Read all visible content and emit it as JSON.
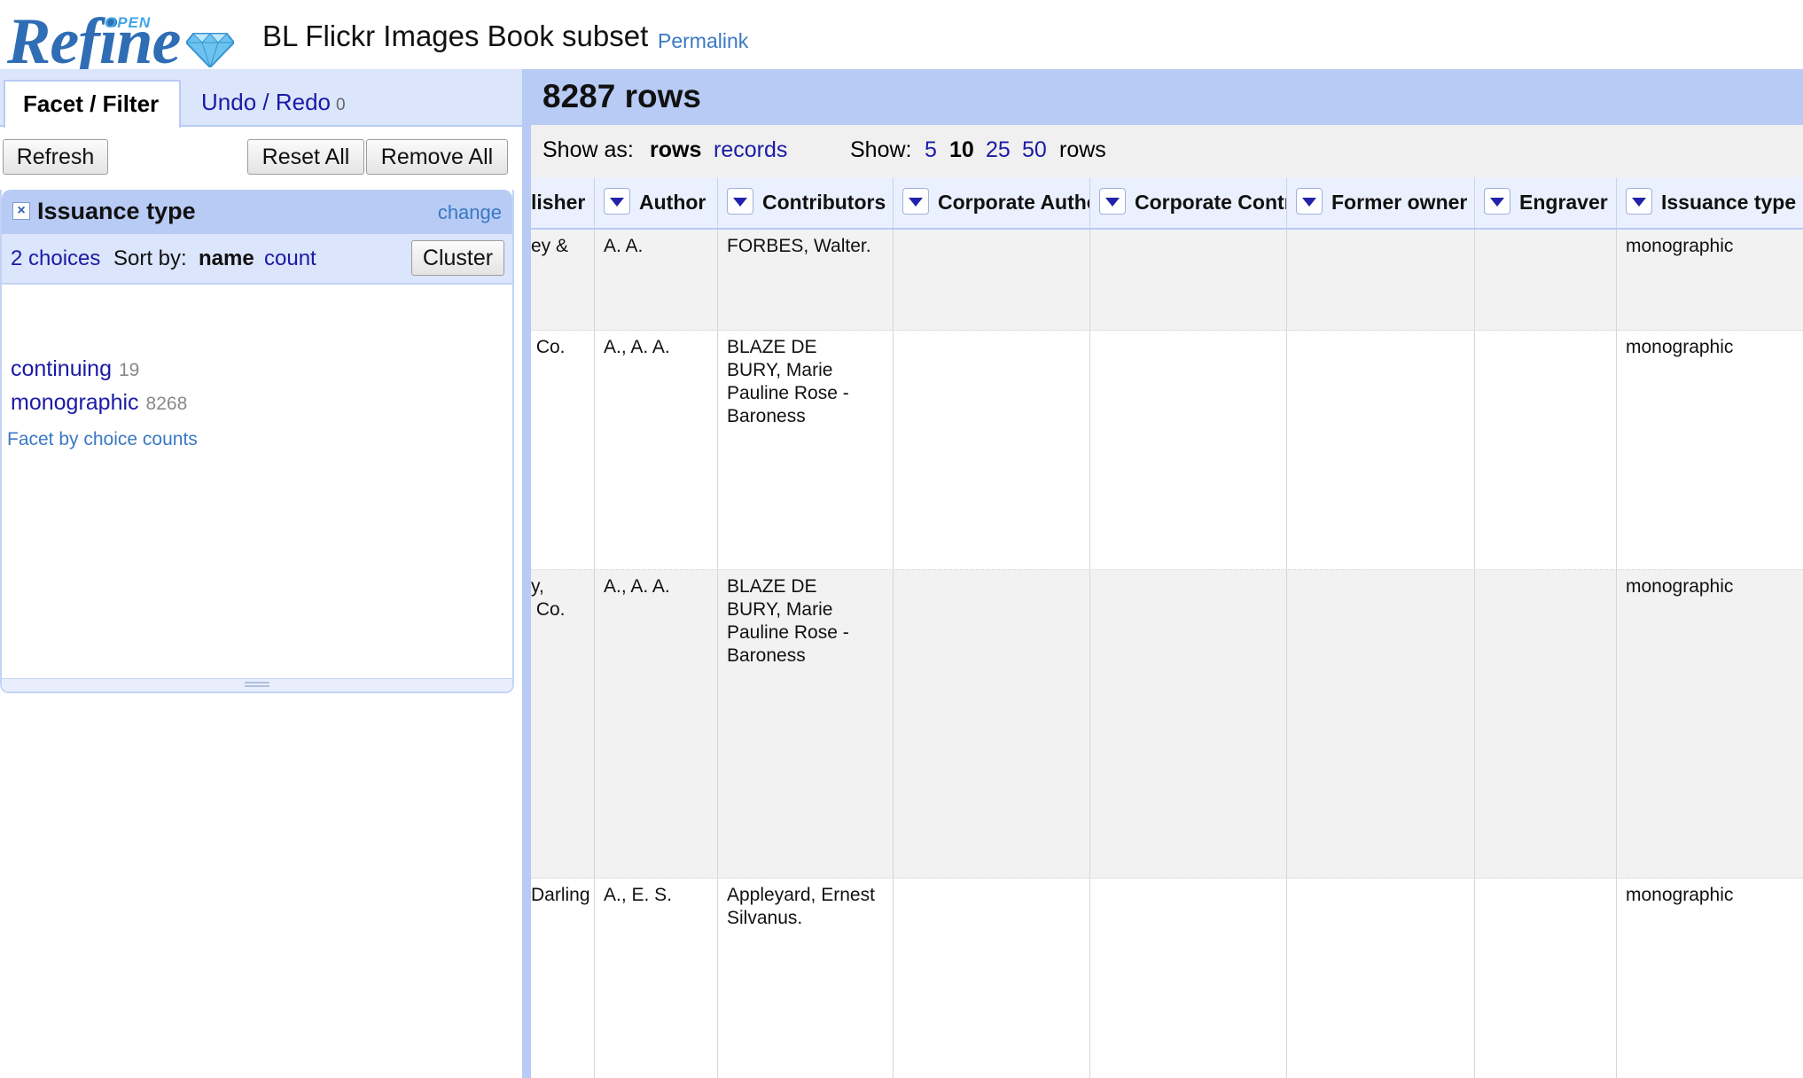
{
  "header": {
    "logo_text": "Refine",
    "logo_badge": "OPEN",
    "project_title": "BL Flickr Images Book subset",
    "permalink_label": "Permalink"
  },
  "left_panel": {
    "tabs": [
      {
        "label": "Facet / Filter"
      },
      {
        "label": "Undo / Redo",
        "count": "0"
      }
    ],
    "buttons": {
      "refresh": "Refresh",
      "reset_all": "Reset All",
      "remove_all": "Remove All"
    },
    "facet": {
      "title": "Issuance type",
      "change_label": "change",
      "choices_summary": "2 choices",
      "sort_by_label": "Sort by:",
      "sort_name": "name",
      "sort_count": "count",
      "cluster_label": "Cluster",
      "choices": [
        {
          "name": "continuing",
          "count": "19"
        },
        {
          "name": "monographic",
          "count": "8268"
        }
      ],
      "facet_by_counts": "Facet by choice counts"
    }
  },
  "grid": {
    "row_count": "8287 rows",
    "show_as_label": "Show as:",
    "show_as_rows": "rows",
    "show_as_records": "records",
    "show_label": "Show:",
    "page_sizes": [
      "5",
      "10",
      "25",
      "50"
    ],
    "active_page_size": "10",
    "rows_suffix": "rows",
    "columns": [
      "lisher",
      "Author",
      "Contributors",
      "Corporate Autho",
      "Corporate Contr",
      "Former owner",
      "Engraver",
      "Issuance type"
    ],
    "rows": [
      {
        "publisher": "ey &",
        "author": "A. A.",
        "contributors": "FORBES, Walter.",
        "issuance": "monographic"
      },
      {
        "publisher": " Co.",
        "author": "A., A. A.",
        "contributors": "BLAZE DE\nBURY, Marie\nPauline Rose -\nBaroness",
        "issuance": "monographic"
      },
      {
        "publisher": "y,\n Co.",
        "author": "A., A. A.",
        "contributors": "BLAZE DE\nBURY, Marie\nPauline Rose -\nBaroness",
        "issuance": "monographic"
      },
      {
        "publisher": "Darling",
        "author": "A., E. S.",
        "contributors": "Appleyard, Ernest\nSilvanus.",
        "issuance": "monographic"
      }
    ]
  },
  "colors": {
    "header_blue": "#b8cbf5",
    "light_blue": "#dbe5fb",
    "link": "#1a1aa6",
    "logo_blue": "#2f6db5"
  }
}
